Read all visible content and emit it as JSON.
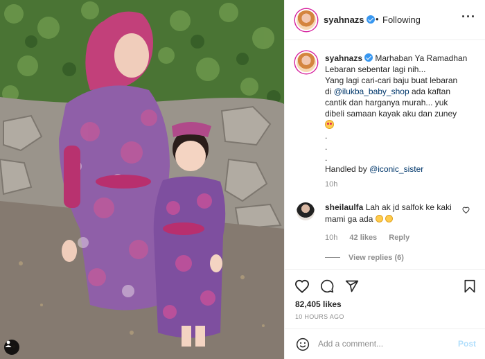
{
  "post": {
    "username": "syahnazs",
    "follow_status": "Following",
    "separator": "•",
    "more": "···"
  },
  "caption": {
    "username": "syahnazs",
    "lines": [
      "Marhaban Ya Ramadhan",
      "Lebaran sebentar lagi nih...",
      "Yang lagi cari-cari baju buat lebaran",
      "di",
      "@ilukba_baby_shop",
      "ada kaftan",
      "cantik dan harganya murah... yuk",
      "dibeli samaan kayak aku dan zuney",
      ".",
      ".",
      ".",
      "Handled by",
      "@iconic_sister"
    ],
    "time": "10h"
  },
  "comment": {
    "username": "sheilaulfa",
    "text": "Lah ak jd salfok ke kaki mami ga ada",
    "time": "10h",
    "likes": "42 likes",
    "reply": "Reply",
    "view_replies": "View replies (6)"
  },
  "stats": {
    "likes": "82,405 likes",
    "ago": "10 HOURS AGO"
  },
  "composer": {
    "placeholder": "Add a comment...",
    "post_label": "Post"
  },
  "icons": {
    "more": "more-options-icon",
    "verified": "verified-badge-icon",
    "like": "heart-icon",
    "comment": "comment-bubble-icon",
    "share": "paper-plane-icon",
    "save": "bookmark-icon",
    "emoji": "smiley-icon",
    "tag": "user-tag-icon"
  },
  "colors": {
    "link": "#00376b",
    "verified": "#3897f0",
    "post_disabled": "#b2dffc",
    "muted": "#8e8e8e"
  }
}
